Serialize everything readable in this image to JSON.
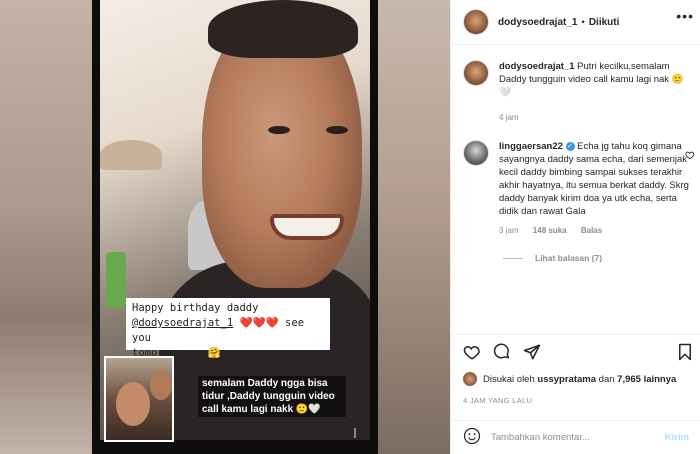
{
  "media": {
    "card_line1": "Happy birthday daddy",
    "card_handle": "@dodysoedrajat_1",
    "card_hearts": "❤️❤️❤️",
    "card_line2_tail": "see you",
    "card_line3": "tomorrow...",
    "card_emoji": "🤗",
    "caption": "semalam Daddy ngga bisa tidur ,Daddy tungguin video call kamu lagi nakk 🙂🤍"
  },
  "header": {
    "username": "dodysoedrajat_1",
    "separator": "•",
    "follow_status": "Diikuti",
    "more_icon": "•••"
  },
  "caption_comment": {
    "username": "dodysoedrajat_1",
    "text": "Putri kecilku,semalam Daddy tungguin video call kamu lagi nak 🙂🤍",
    "time": "4 jam"
  },
  "comment": {
    "username": "linggaersan22",
    "verified_icon": "✓",
    "text": "Echa jg tahu koq gimana sayangnya daddy sama echa, dari semenjak kecil daddy bimbing sampai sukses terakhir akhir hayatnya, itu semua berkat daddy. Skrg daddy banyak kirim doa ya utk echa, serta didik dan rawat Gala",
    "time": "3 jam",
    "likes": "148 suka",
    "reply": "Balas",
    "view_replies": "Lihat balasan (7)"
  },
  "actions": {
    "like_icon": "heart-icon",
    "comment_icon": "comment-icon",
    "share_icon": "share-icon",
    "save_icon": "bookmark-icon"
  },
  "likes": {
    "prefix": "Disukai oleh",
    "user": "ussypratama",
    "connector": "dan",
    "count": "7,965 lainnya"
  },
  "timestamp": "4 JAM YANG LALU",
  "add_comment": {
    "emoji_icon": "☺",
    "placeholder": "Tambahkan komentar...",
    "post_label": "Kirim"
  }
}
